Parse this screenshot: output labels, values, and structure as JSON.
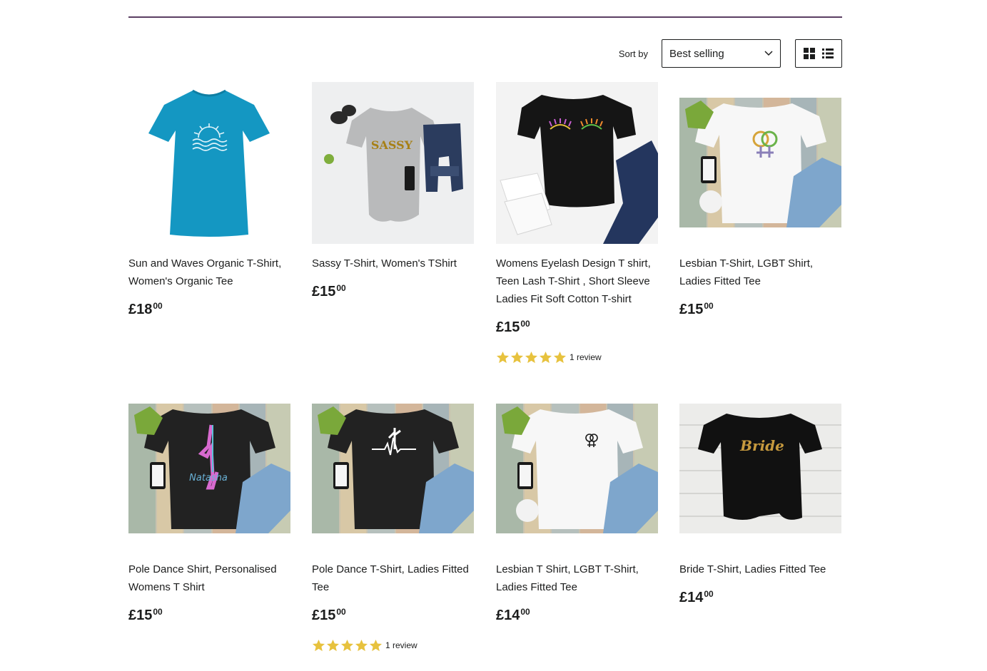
{
  "toolbar": {
    "sort_label": "Sort by",
    "sort_value": "Best selling",
    "grid_view_icon": "grid-view-icon",
    "list_view_icon": "list-view-icon"
  },
  "colors": {
    "accent_rule": "#5b3f63",
    "star": "#e7c23e",
    "text": "#1c1d1d"
  },
  "products": [
    {
      "title": "Sun and Waves Organic T-Shirt, Women's Organic Tee",
      "price_major": "£18",
      "price_minor": "00",
      "image": "turquoise-tshirt-sun-waves"
    },
    {
      "title": "Sassy T-Shirt, Women's TShirt",
      "price_major": "£15",
      "price_minor": "00",
      "image": "grey-tshirt-sassy"
    },
    {
      "title": "Womens Eyelash Design T shirt, Teen Lash T-Shirt , Short Sleeve Ladies Fit Soft Cotton T-shirt",
      "price_major": "£15",
      "price_minor": "00",
      "image": "black-tshirt-eyelashes",
      "rating": 5,
      "review_text": "1 review"
    },
    {
      "title": "Lesbian T-Shirt, LGBT Shirt, Ladies Fitted Tee",
      "price_major": "£15",
      "price_minor": "00",
      "image": "white-tshirt-female-symbols-large"
    },
    {
      "title": "Pole Dance Shirt, Personalised Womens T Shirt",
      "price_major": "£15",
      "price_minor": "00",
      "image": "black-tshirt-pole-dancer-natasha"
    },
    {
      "title": "Pole Dance T-Shirt, Ladies Fitted Tee",
      "price_major": "£15",
      "price_minor": "00",
      "image": "black-tshirt-pole-heartbeat",
      "rating": 5,
      "review_text": "1 review"
    },
    {
      "title": "Lesbian T Shirt, LGBT T-Shirt, Ladies Fitted Tee",
      "price_major": "£14",
      "price_minor": "00",
      "image": "white-tshirt-female-symbols-small"
    },
    {
      "title": "Bride T-Shirt, Ladies Fitted Tee",
      "price_major": "£14",
      "price_minor": "00",
      "image": "black-tshirt-bride"
    }
  ]
}
